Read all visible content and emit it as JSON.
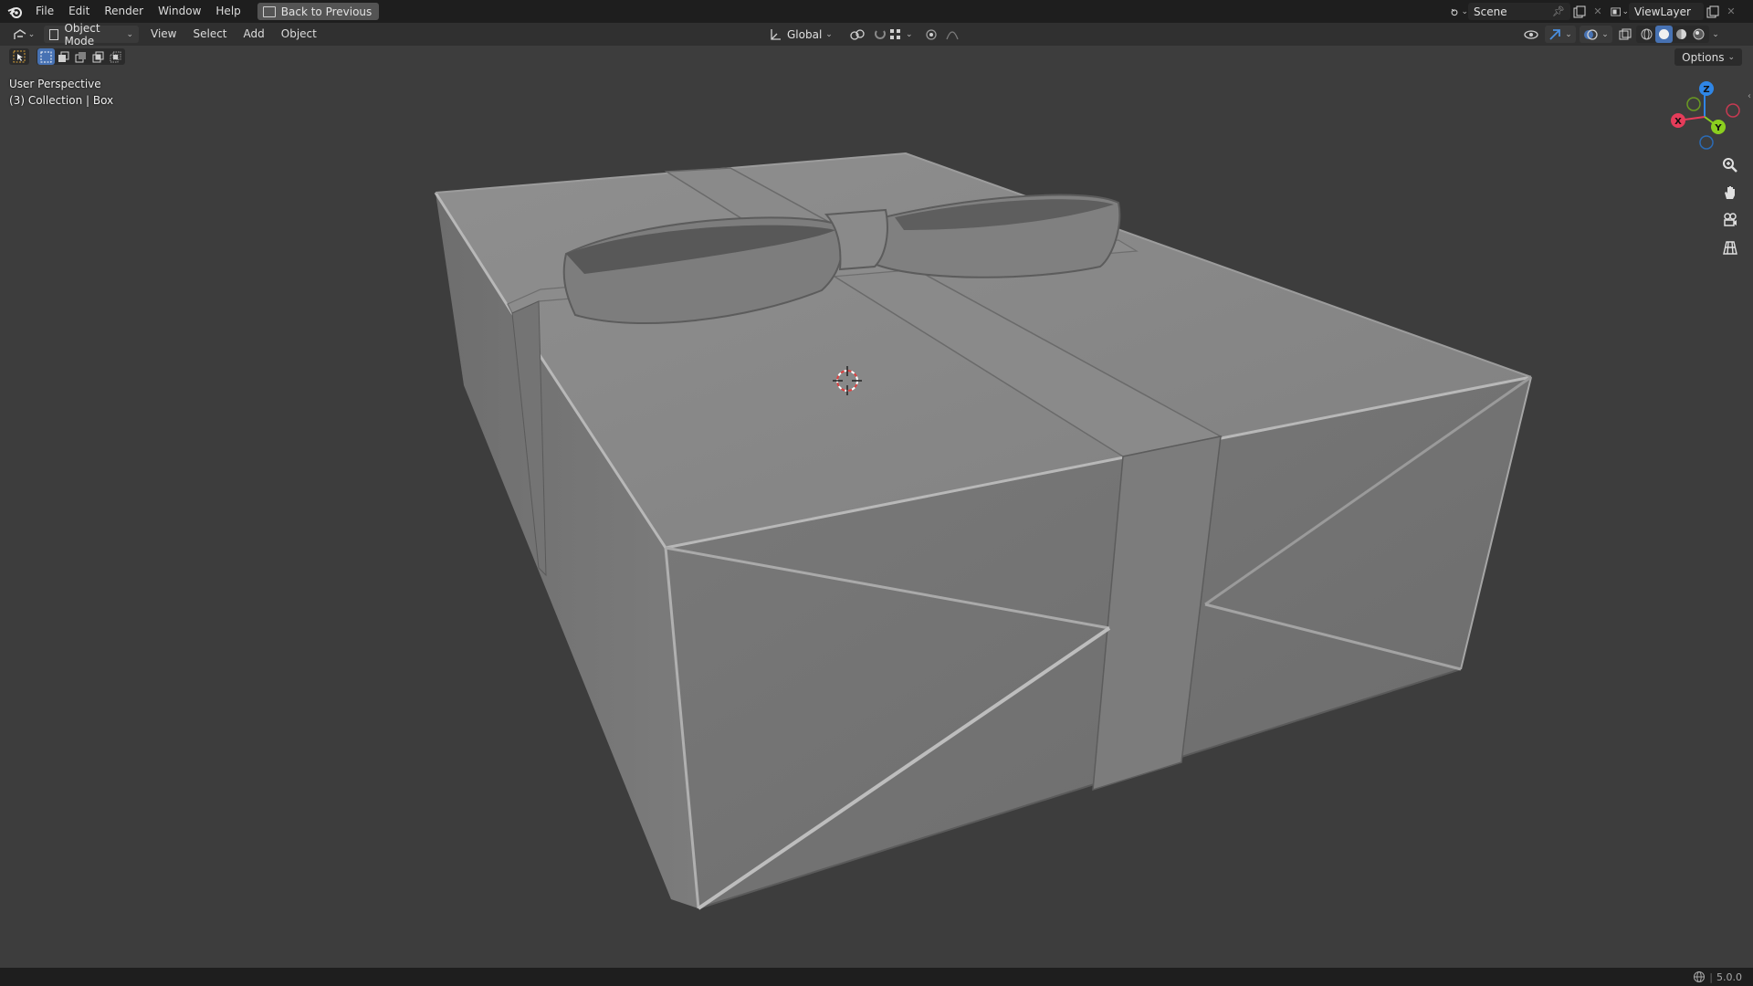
{
  "topbar": {
    "menus": [
      "File",
      "Edit",
      "Render",
      "Window",
      "Help"
    ],
    "back_button": "Back to Previous",
    "scene": "Scene",
    "view_layer": "ViewLayer"
  },
  "header": {
    "mode": "Object Mode",
    "menus": [
      "View",
      "Select",
      "Add",
      "Object"
    ],
    "transform_orientation": "Global",
    "options": "Options"
  },
  "viewport": {
    "view_name": "User Perspective",
    "collection_info": "(3) Collection | Box",
    "gizmo_axes": {
      "x": "X",
      "y": "Y",
      "z": "Z"
    },
    "axis_colors": {
      "x": "#e63c5a",
      "y": "#8bcf1f",
      "z": "#2f86e6"
    }
  },
  "statusbar": {
    "version": "5.0.0"
  },
  "colors": {
    "background": "#3d3d3d",
    "topbar": "#1e1e1e",
    "header": "#303030",
    "accent": "#4772b3"
  }
}
